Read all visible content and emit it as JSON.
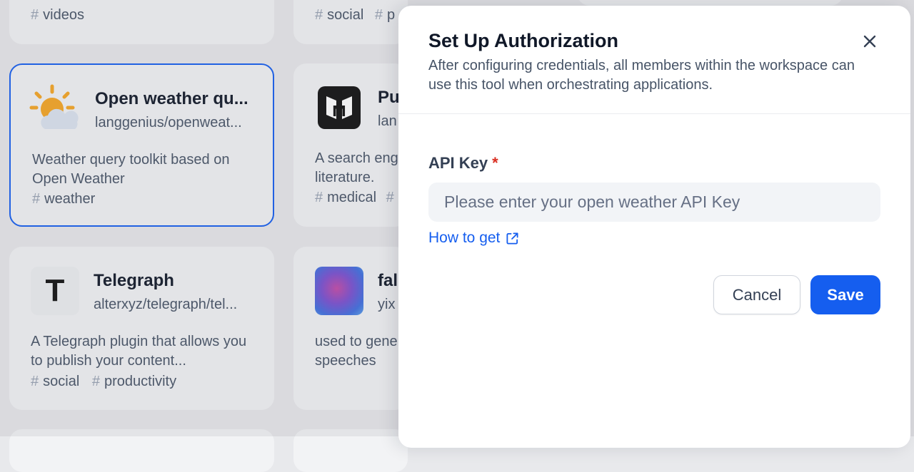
{
  "background": {
    "top_tags": {
      "card1": [
        {
          "label": "videos"
        }
      ],
      "card2": [
        {
          "label": "social"
        },
        {
          "label": "p"
        }
      ]
    },
    "cards": [
      {
        "title": "Open weather qu...",
        "subtitle": "langgenius/openweat...",
        "description": "Weather query toolkit based on Open Weather",
        "tags": [
          "weather"
        ],
        "icon": "sun-cloud-icon"
      },
      {
        "title": "Pu",
        "subtitle": "lan",
        "description": "A search eng literature.",
        "tags": [
          "medical",
          ""
        ],
        "icon": "book-m-icon"
      },
      {
        "title": "Telegraph",
        "subtitle": "alterxyz/telegraph/tel...",
        "description": "A Telegraph plugin that allows you to publish your content...",
        "tags": [
          "social",
          "productivity"
        ],
        "icon": "telegraph-t-icon",
        "icon_letter": "T"
      },
      {
        "title": "fal",
        "subtitle": "yix",
        "description": "used to gene speeches",
        "tags": [],
        "icon": "gradient-avatar-icon"
      }
    ]
  },
  "dialog": {
    "title": "Set Up Authorization",
    "description": "After configuring credentials, all members within the workspace can use this tool when orchestrating applications.",
    "close_icon": "close-icon",
    "field_label": "API Key",
    "required_mark": "*",
    "input_placeholder": "Please enter your open weather API Key",
    "input_value": "",
    "help_link": "How to get",
    "help_icon": "external-link-icon",
    "cancel_label": "Cancel",
    "save_label": "Save",
    "accent_color": "#155eef"
  }
}
